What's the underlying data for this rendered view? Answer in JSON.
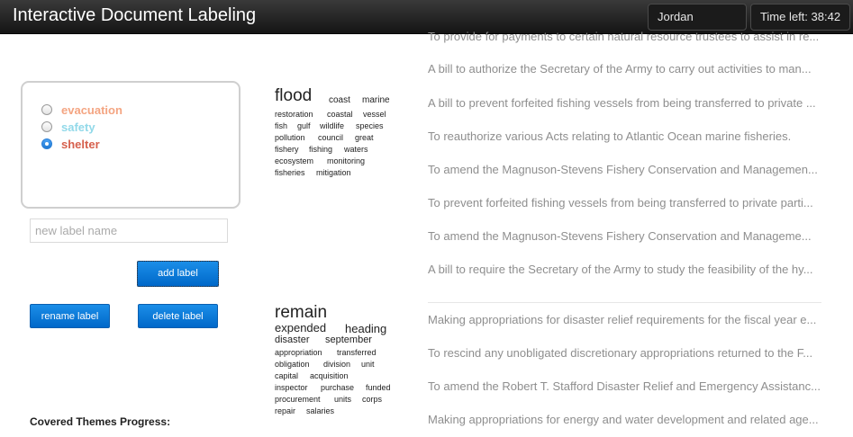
{
  "header": {
    "title": "Interactive Document Labeling",
    "user": "Jordan",
    "timer": "Time left: 38:42"
  },
  "labels": [
    {
      "name": "evacuation",
      "color": "#f4a582",
      "checked": false
    },
    {
      "name": "safety",
      "color": "#92d9e9",
      "checked": false
    },
    {
      "name": "shelter",
      "color": "#d6604d",
      "checked": true
    }
  ],
  "new_label": {
    "placeholder": "new label name",
    "value": ""
  },
  "buttons": {
    "add": "add label",
    "rename": "rename label",
    "delete": "delete label"
  },
  "progress_label": "Covered Themes Progress:",
  "topics": [
    {
      "top_word": "flood",
      "words": [
        "coast",
        "marine",
        "restoration",
        "coastal",
        "vessel",
        "fish",
        "gulf",
        "wildlife",
        "species",
        "pollution",
        "council",
        "great",
        "fishery",
        "fishing",
        "waters",
        "ecosystem",
        "monitoring",
        "fisheries",
        "mitigation"
      ],
      "documents": [
        "To provide for payments to certain natural resource trustees to assist in re...",
        "A bill to authorize the Secretary of the Army to carry out activities to man...",
        "A bill to prevent forfeited fishing vessels from being transferred to private ...",
        "To reauthorize various Acts relating to Atlantic Ocean marine fisheries.",
        "To amend the Magnuson-Stevens Fishery Conservation and Managemen...",
        "To prevent forfeited fishing vessels from being transferred to private parti...",
        "To amend the Magnuson-Stevens Fishery Conservation and Manageme...",
        "A bill to require the Secretary of the Army to study the feasibility of the hy..."
      ]
    },
    {
      "top_word": "remain",
      "words": [
        "expended",
        "heading",
        "disaster",
        "september",
        "appropriation",
        "transferred",
        "obligation",
        "division",
        "unit",
        "capital",
        "acquisition",
        "inspector",
        "purchase",
        "funded",
        "procurement",
        "units",
        "corps",
        "repair",
        "salaries"
      ],
      "documents": [
        "Making appropriations for disaster relief requirements for the fiscal year e...",
        "To rescind any unobligated discretionary appropriations returned to the F...",
        "To amend the Robert T. Stafford Disaster Relief and Emergency Assistanc...",
        "Making appropriations for energy and water development and related age..."
      ]
    }
  ]
}
